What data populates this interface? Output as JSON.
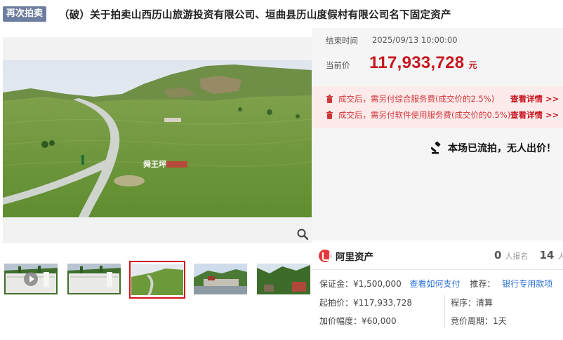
{
  "header": {
    "tag": "再次拍卖",
    "title": "（破）关于拍卖山西历山旅游投资有限公司、垣曲县历山度假村有限公司名下固定资产"
  },
  "gallery": {
    "main_image_sign": "舜王坪",
    "thumbnails": [
      {
        "kind": "video"
      },
      {
        "kind": "image"
      },
      {
        "kind": "image",
        "active": true
      },
      {
        "kind": "image"
      },
      {
        "kind": "image"
      }
    ]
  },
  "auction": {
    "end_time_label": "结束时间",
    "end_time": "2025/09/13 10:00:00",
    "price_label": "当前价",
    "price": "117,933,728",
    "price_unit": "元",
    "notices": [
      {
        "text": "成交后，需另付综合服务费(成交价的2.5%)",
        "link": "查看详情 >>"
      },
      {
        "text": "成交后，需另付软件使用服务费(成交价的0.5%)",
        "link": "查看详情 >>"
      }
    ],
    "status": "本场已流拍，无人出价！"
  },
  "provider": {
    "name": "阿里资产",
    "signups": "0",
    "signups_label": "人报名",
    "second_count": "14",
    "second_label": "人"
  },
  "details": {
    "deposit": "保证金：¥1,500,000",
    "deposit_link": "查看如何支付",
    "recommend_label": "推荐：",
    "recommend_link": "银行专用款项",
    "start_price": "起拍价：¥117,933,728",
    "procedure": "程序：清算",
    "increment": "加价幅度：¥60,000",
    "cycle": "竞价周期：1天"
  },
  "colors": {
    "accent_red": "#c8161e",
    "tag_bg": "#6d7ea0",
    "link_blue": "#2a6fd6",
    "notice_bg": "#fdebeb"
  }
}
